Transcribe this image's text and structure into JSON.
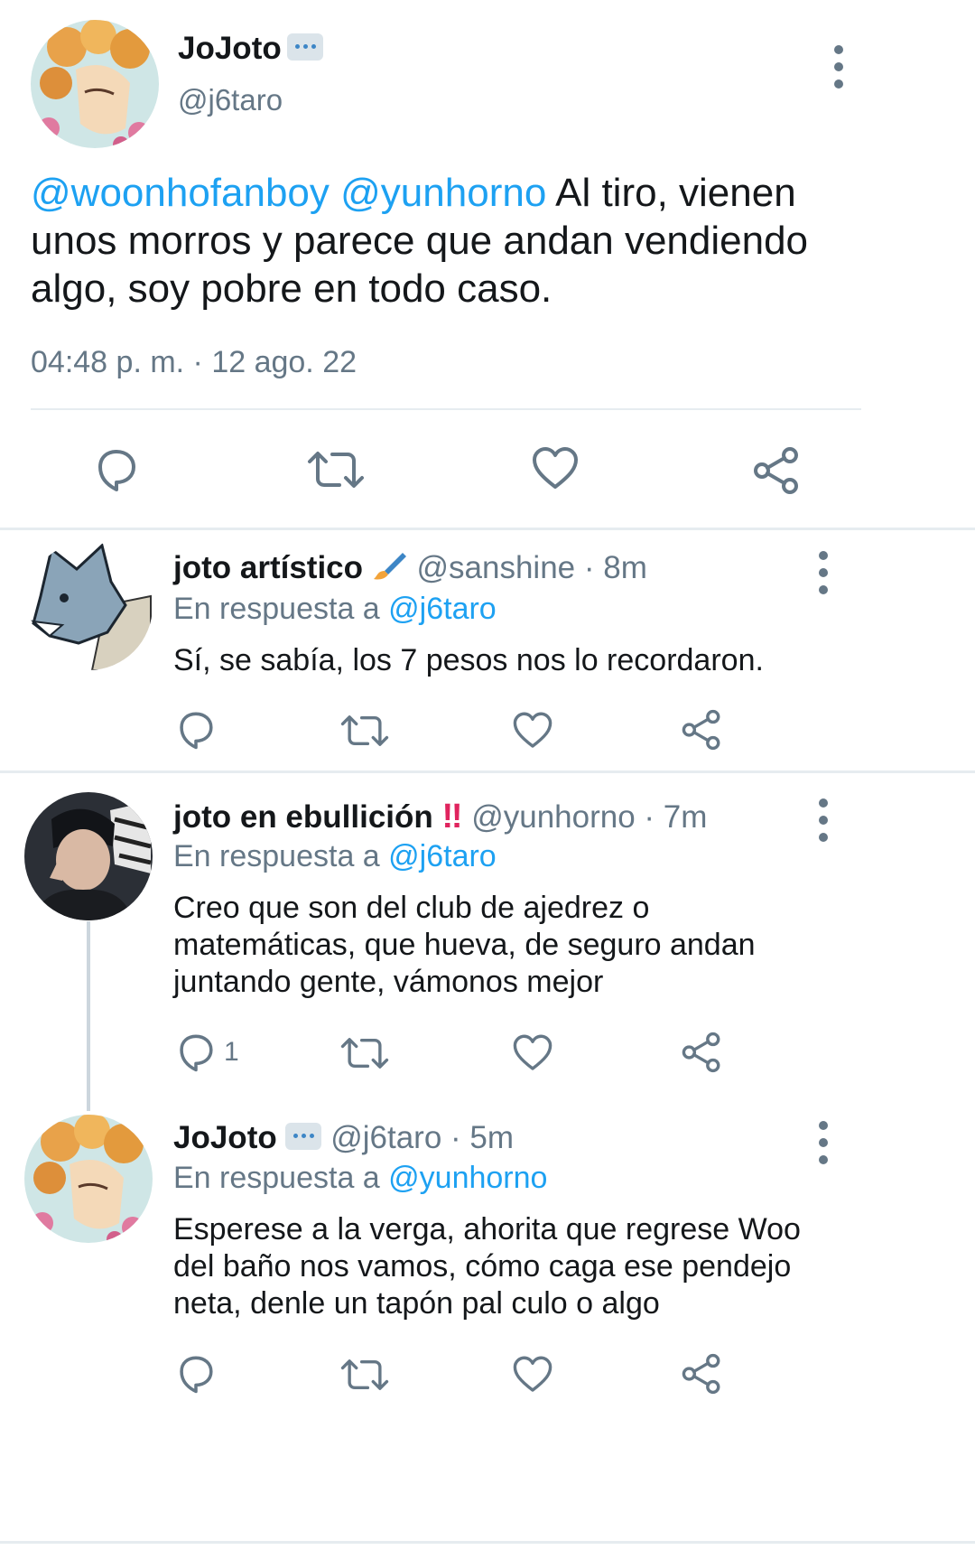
{
  "main_tweet": {
    "author_name": "JoJoto",
    "author_handle": "@j6taro",
    "mention_1": "@woonhofanboy",
    "mention_2": "@yunhorno",
    "text_line_1": " Al tiro, vienen",
    "text_line_2": "unos morros y parece que andan vendiendo",
    "text_line_3": "algo, soy pobre en todo caso.",
    "timestamp": "04:48 p. m. · 12 ago. 22"
  },
  "replies": [
    {
      "author_name": "joto artístico",
      "author_handle": "@sanshine",
      "time": "· 8m",
      "reply_prefix": "En respuesta a",
      "reply_to": "@j6taro",
      "text_lines": [
        "Sí, se sabía, los 7 pesos nos lo recordaron."
      ],
      "reply_count": ""
    },
    {
      "author_name": "joto en ebullición",
      "author_handle": "@yunhorno",
      "time": "· 7m",
      "reply_prefix": "En respuesta a",
      "reply_to": "@j6taro",
      "text_lines": [
        "Creo que son del club de ajedrez o",
        "matemáticas, que hueva, de seguro andan",
        "juntando gente, vámonos mejor"
      ],
      "reply_count": "1"
    },
    {
      "author_name": "JoJoto",
      "author_handle": "@j6taro",
      "time": "· 5m",
      "reply_prefix": "En respuesta a",
      "reply_to": "@yunhorno",
      "text_lines": [
        "Esperese a la verga, ahorita que regrese Woo",
        "del baño nos vamos, cómo caga ese pendejo",
        "neta, denle un tapón pal culo o algo"
      ],
      "reply_count": ""
    }
  ],
  "emoji": {
    "speech_bubble": "speech-bubble-icon",
    "paintbrush": "paintbrush-icon",
    "double_exclamation": "‼"
  },
  "colors": {
    "accent": "#1da1f2",
    "secondary_text": "#657786",
    "divider": "#e6ecf0",
    "primary_text": "#14171a"
  }
}
